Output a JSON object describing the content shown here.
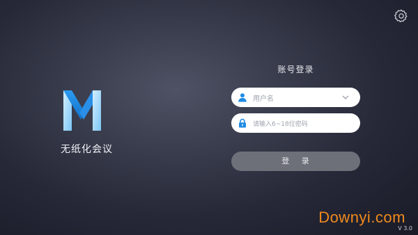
{
  "header": {
    "settings_icon": "gear-icon"
  },
  "brand": {
    "app_name": "无纸化会议",
    "logo_icon": "m-logo-icon"
  },
  "login": {
    "title": "账号登录",
    "username": {
      "placeholder": "用户名",
      "icon": "user-icon",
      "dropdown_icon": "chevron-down-icon"
    },
    "password": {
      "placeholder": "请输入6~18位密码",
      "icon": "lock-icon"
    },
    "submit_label": "登 录"
  },
  "watermark": "Downyi.com",
  "version": "V 3.0",
  "colors": {
    "accent_blue": "#1f8be4",
    "logo_light": "#bfe4ff",
    "button_bg": "#6d7079",
    "watermark": "#f08a1c"
  }
}
